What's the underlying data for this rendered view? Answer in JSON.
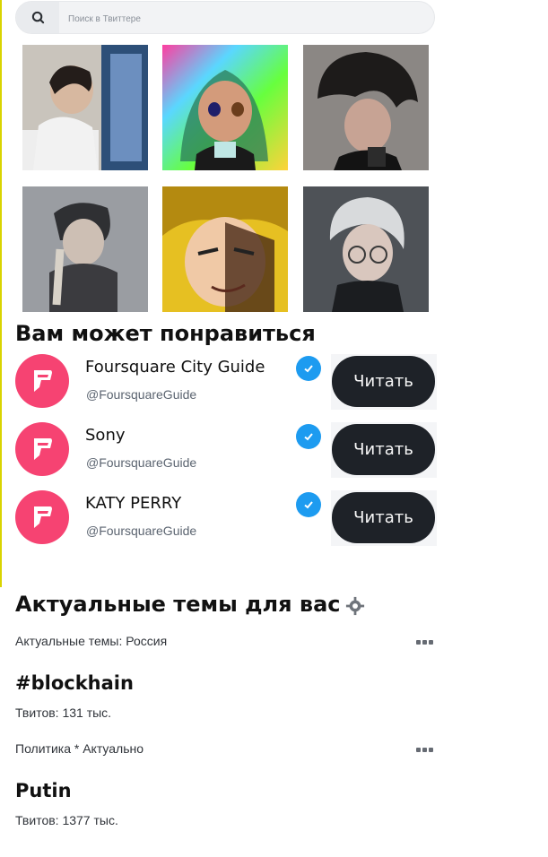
{
  "search": {
    "placeholder": "Поиск в Твиттере"
  },
  "media_grid": {
    "images": [
      {
        "name": "photo-1"
      },
      {
        "name": "photo-2"
      },
      {
        "name": "photo-3"
      },
      {
        "name": "photo-4"
      },
      {
        "name": "photo-5"
      },
      {
        "name": "photo-6"
      }
    ]
  },
  "suggestions": {
    "title": "Вам может понравиться",
    "follow_label": "Читать",
    "items": [
      {
        "name": "Foursquare City Guide",
        "handle": "@FoursquareGuide"
      },
      {
        "name": "Sony",
        "handle": "@FoursquareGuide"
      },
      {
        "name": "KATY PERRY",
        "handle": "@FoursquareGuide"
      }
    ]
  },
  "trends": {
    "title": "Актуальные темы для вас",
    "items": [
      {
        "context": "Актуальные темы: Россия",
        "topic": "#blockhain",
        "count": "Твитов: 131 тыс."
      },
      {
        "context": "Политика * Актуально",
        "topic": "Putin",
        "count": "Твитов: 1377 тыс."
      }
    ]
  },
  "colors": {
    "avatar": "#f64372",
    "verified": "#1d9bf0",
    "follow_button": "#1e2228"
  },
  "icons": [
    "search-icon",
    "foursquare-icon",
    "verified-icon",
    "settings-gear-icon",
    "more-icon"
  ]
}
